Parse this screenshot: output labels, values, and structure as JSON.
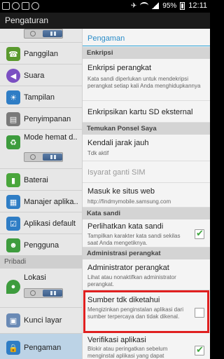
{
  "status_bar": {
    "battery_percent": "95%",
    "time": "12:11",
    "icons": [
      "photo-icon",
      "android-icon",
      "usb-icon",
      "sync-icon",
      "airplane-icon",
      "wifi-icon",
      "signal-icon",
      "battery-icon"
    ]
  },
  "app": {
    "title": "Pengaturan"
  },
  "sidebar": {
    "items": [
      {
        "label": "Panggilan",
        "icon": "phone-icon",
        "color": "#5a9a2e"
      },
      {
        "label": "Suara",
        "icon": "volume-icon",
        "color": "#7b4fc2"
      },
      {
        "label": "Tampilan",
        "icon": "brightness-icon",
        "color": "#2f7dc5"
      },
      {
        "label": "Penyimpanan",
        "icon": "sd-card-icon",
        "color": "#7a7a7a"
      },
      {
        "label": "Mode hemat d..",
        "icon": "recycle-icon",
        "color": "#3e9c3e"
      },
      {
        "label": "Baterai",
        "icon": "battery-icon",
        "color": "#4aa63c"
      },
      {
        "label": "Manajer aplika..",
        "icon": "apps-grid-icon",
        "color": "#2f7dc5"
      },
      {
        "label": "Aplikasi default",
        "icon": "checklist-icon",
        "color": "#2f7dc5"
      },
      {
        "label": "Pengguna",
        "icon": "user-icon",
        "color": "#3e9c3e"
      },
      {
        "label": "Lokasi",
        "icon": "location-icon",
        "color": "#3e9c3e"
      },
      {
        "label": "Kunci layar",
        "icon": "lock-screen-icon",
        "color": "#6a8ab5"
      },
      {
        "label": "Pengaman",
        "icon": "lock-icon",
        "color": "#2f7dc5"
      }
    ],
    "section_pribadi": "Pribadi",
    "selected": "Pengaman"
  },
  "content": {
    "header": "Pengaman",
    "sections": {
      "enkripsi": "Enkripsi",
      "temukan": "Temukan Ponsel Saya",
      "kata_sandi": "Kata sandi",
      "admin": "Administrasi perangkat"
    },
    "items": {
      "enkripsi_perangkat": {
        "title": "Enkripsi perangkat",
        "desc": "Kata sandi diperlukan untuk mendekripsi perangkat setiap kali Anda menghidupkannya"
      },
      "enkripsi_sd": {
        "title": "Enkripsikan kartu SD eksternal"
      },
      "kendali": {
        "title": "Kendali jarak jauh",
        "desc": "Tdk aktif"
      },
      "isyarat": {
        "title": "Isyarat ganti SIM"
      },
      "masuk": {
        "title": "Masuk ke situs web",
        "desc": "http://findmymobile.samsung.com"
      },
      "perlihatkan": {
        "title": "Perlihatkan kata sandi",
        "desc": "Tampilkan karakter kata sandi sekilas saat Anda mengetiknya.",
        "checked": true
      },
      "administrator": {
        "title": "Administrator perangkat",
        "desc": "Lihat atau nonaktifkan administrator perangkat."
      },
      "sumber": {
        "title": "Sumber tdk diketahui",
        "desc": "Mengizinkan penginstalan aplikasi dari sumber terpercaya dan tidak dikenal.",
        "checked": false
      },
      "verifikasi": {
        "title": "Verifikasi aplikasi",
        "desc": "Blokir atau peringatkan sebelum menginstal aplikasi yang dapat membahayakan",
        "checked": true
      }
    }
  }
}
